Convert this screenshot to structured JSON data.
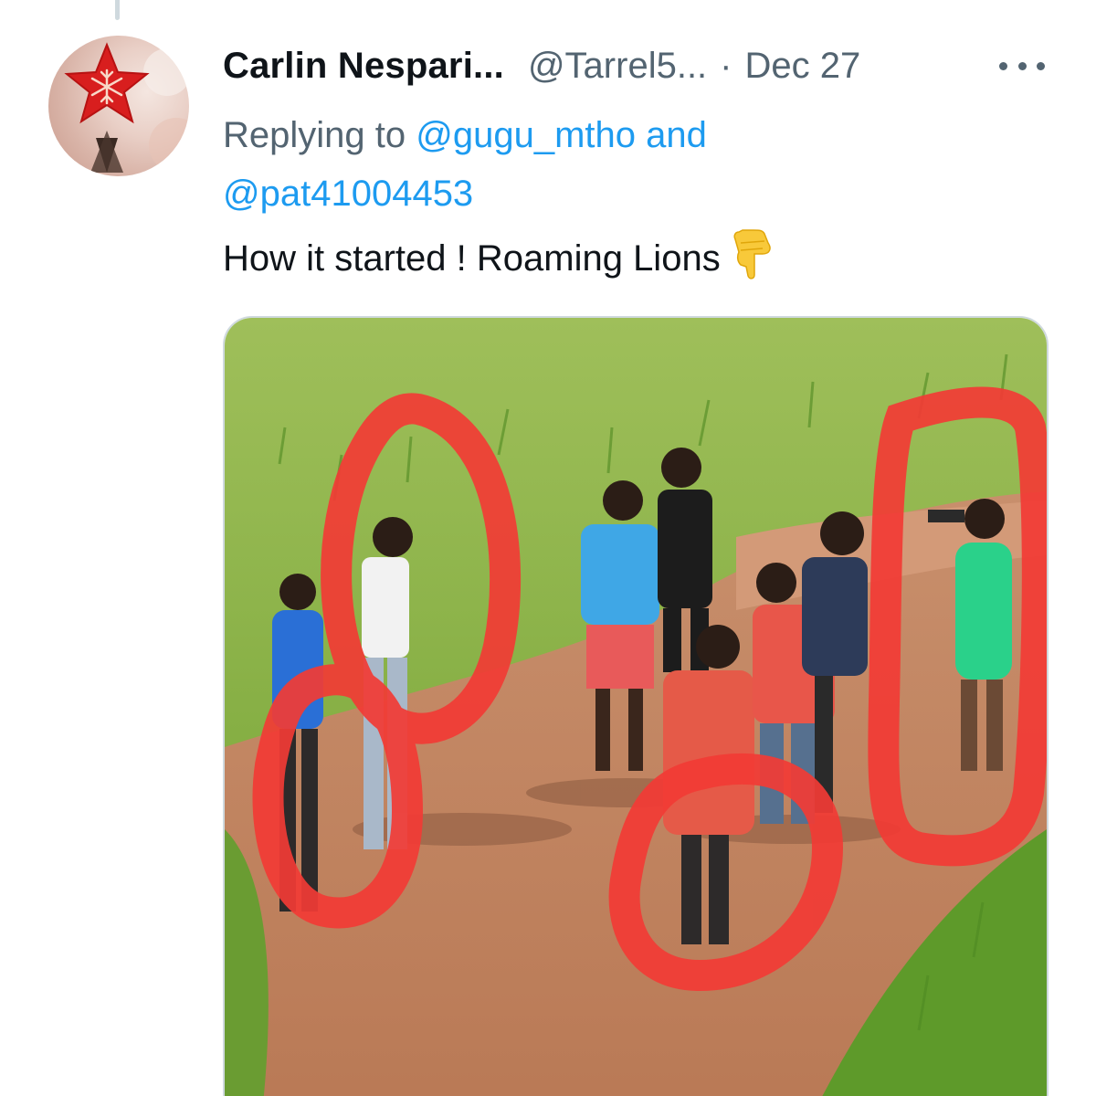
{
  "tweet": {
    "display_name": "Carlin Nespari...",
    "handle": "@Tarrel5...",
    "separator": "·",
    "date": "Dec 27",
    "replying_prefix": "Replying to",
    "reply_mentions": [
      "@gugu_mtho",
      "@pat41004453"
    ],
    "reply_conjunction": "and",
    "text": "How it started ! Roaming Lions",
    "emoji_icon": "pointing-down-hand-icon",
    "more_icon": "more-options-icon",
    "avatar_icon": "christmas-star-icon"
  },
  "colors": {
    "link": "#1d9bf0",
    "secondary_text": "#536471",
    "primary_text": "#0f1419",
    "annotation_red": "#f23b35"
  }
}
